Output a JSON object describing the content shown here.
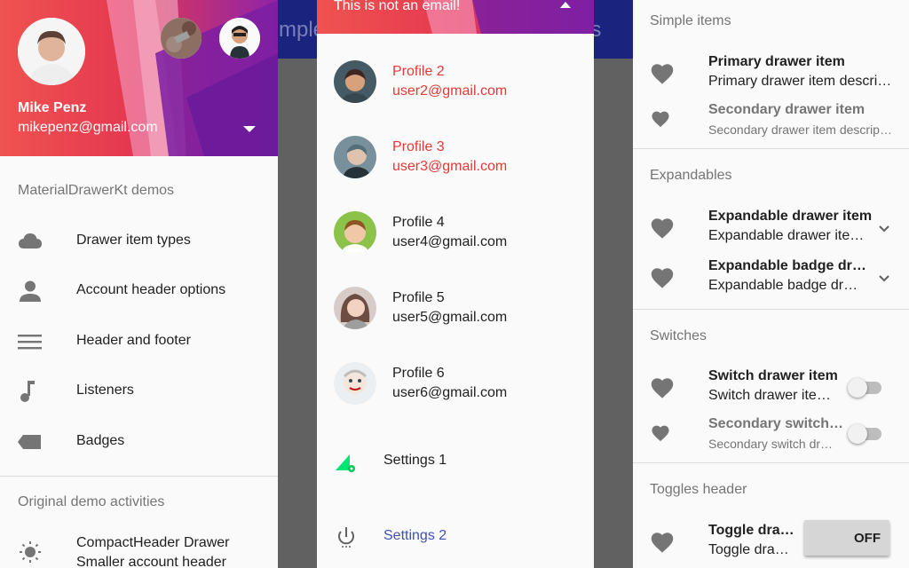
{
  "background_app": {
    "title_left": "mple",
    "title_right": "ns"
  },
  "left_drawer": {
    "account": {
      "name": "Mike Penz",
      "email": "mikepenz@gmail.com"
    },
    "section_demos": "MaterialDrawerKt demos",
    "items": [
      {
        "label": "Drawer item types",
        "icon": "cloud-icon"
      },
      {
        "label": "Account header options",
        "icon": "person-icon"
      },
      {
        "label": "Header and footer",
        "icon": "menu-icon"
      },
      {
        "label": "Listeners",
        "icon": "music-note-icon"
      },
      {
        "label": "Badges",
        "icon": "label-icon"
      }
    ],
    "section_original": "Original demo activities",
    "compact": {
      "label": "CompactHeader Drawer",
      "sub": "Smaller account header",
      "icon": "brightness-icon"
    }
  },
  "middle_drawer": {
    "header_text": "This is not an email!",
    "profiles": [
      {
        "name": "Profile 2",
        "email": "user2@gmail.com",
        "active": true
      },
      {
        "name": "Profile 3",
        "email": "user3@gmail.com",
        "active": true
      },
      {
        "name": "Profile 4",
        "email": "user4@gmail.com",
        "active": false
      },
      {
        "name": "Profile 5",
        "email": "user5@gmail.com",
        "active": false
      },
      {
        "name": "Profile 6",
        "email": "user6@gmail.com",
        "active": false
      }
    ],
    "settings": [
      {
        "label": "Settings 1",
        "icon": "settings-signal-icon",
        "color": "#212121"
      },
      {
        "label": "Settings 2",
        "icon": "power-icon",
        "color": "#3f51b5"
      }
    ]
  },
  "right_drawer": {
    "simple": {
      "header": "Simple items",
      "primary_title": "Primary drawer item",
      "primary_desc": "Primary drawer item descri…",
      "secondary_title": "Secondary drawer item",
      "secondary_desc": "Secondary drawer item descrip…"
    },
    "expandables": {
      "header": "Expandables",
      "item1_title": "Expandable drawer item",
      "item1_desc": "Expandable drawer ite…",
      "item2_title": "Expandable badge dr…",
      "item2_desc": "Expandable badge dr…"
    },
    "switches": {
      "header": "Switches",
      "item1_title": "Switch drawer item",
      "item1_desc": "Switch drawer ite…",
      "item2_title": "Secondary switch…",
      "item2_desc": "Secondary switch dr…"
    },
    "toggles": {
      "header": "Toggles header",
      "item_title": "Toggle dra…",
      "item_desc": "Toggle dra…",
      "button_label": "OFF"
    }
  },
  "colors": {
    "accent_red": "#e53935",
    "accent_indigo": "#3f51b5",
    "header_gradient_start": "#ef5350",
    "header_gradient_end": "#8e24aa",
    "settings_icon_green": "#00e676"
  }
}
